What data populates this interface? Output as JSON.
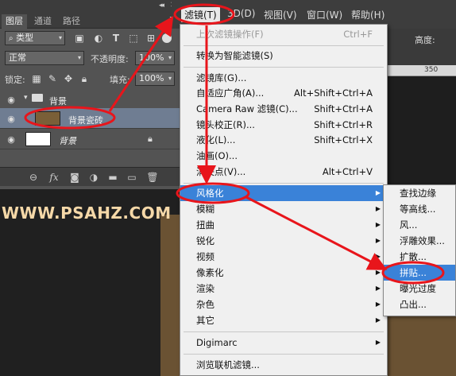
{
  "ruler": {
    "tick_350": "350"
  },
  "layers_panel": {
    "tabs": [
      "图层",
      "通道",
      "路径"
    ],
    "collapse": "◂◂",
    "panel_close": "✕",
    "menu_icon": "≡",
    "filter_kind": "类型",
    "blend_mode": "正常",
    "opacity_label": "不透明度:",
    "opacity_value": "100%",
    "lock_label": "锁定:",
    "fill_label": "填充:",
    "fill_value": "100%",
    "layers": [
      {
        "name": "背景",
        "type": "group"
      },
      {
        "name": "背景瓷砖",
        "selected": true,
        "thumb_color": "#7a5f38"
      },
      {
        "name": "背景",
        "locked": true,
        "thumb_color": "#ffffff"
      }
    ]
  },
  "menubar": {
    "items": [
      "滤镜(T)",
      "3D(D)",
      "视图(V)",
      "窗口(W)",
      "帮助(H)"
    ],
    "open": "滤镜(T)",
    "right_partial": "高度:"
  },
  "filter_menu": {
    "items": [
      {
        "label": "上次滤镜操作(F)",
        "shortcut": "Ctrl+F",
        "disabled": true
      },
      {
        "label": "转换为智能滤镜(S)"
      },
      {
        "label": "滤镜库(G)..."
      },
      {
        "label": "自适应广角(A)...",
        "shortcut": "Alt+Shift+Ctrl+A"
      },
      {
        "label": "Camera Raw 滤镜(C)...",
        "shortcut": "Shift+Ctrl+A"
      },
      {
        "label": "镜头校正(R)...",
        "shortcut": "Shift+Ctrl+R"
      },
      {
        "label": "液化(L)...",
        "shortcut": "Shift+Ctrl+X"
      },
      {
        "label": "油画(O)..."
      },
      {
        "label": "消失点(V)...",
        "shortcut": "Alt+Ctrl+V"
      },
      {
        "label": "风格化",
        "submenu": true,
        "highlighted": true
      },
      {
        "label": "模糊",
        "submenu": true
      },
      {
        "label": "扭曲",
        "submenu": true
      },
      {
        "label": "锐化",
        "submenu": true
      },
      {
        "label": "视频",
        "submenu": true
      },
      {
        "label": "像素化",
        "submenu": true
      },
      {
        "label": "渲染",
        "submenu": true
      },
      {
        "label": "杂色",
        "submenu": true
      },
      {
        "label": "其它",
        "submenu": true
      },
      {
        "label": "Digimarc",
        "submenu": true
      },
      {
        "label": "浏览联机滤镜..."
      }
    ]
  },
  "stylize_submenu": {
    "items": [
      "查找边缘",
      "等高线...",
      "风...",
      "浮雕效果...",
      "扩散...",
      "拼贴...",
      "曝光过度",
      "凸出..."
    ],
    "highlighted": "拼贴..."
  },
  "watermark": "WWW.PSAHZ.COM",
  "colors": {
    "annotation_red": "#e8151b",
    "menu_highlight": "#3a82d8"
  }
}
